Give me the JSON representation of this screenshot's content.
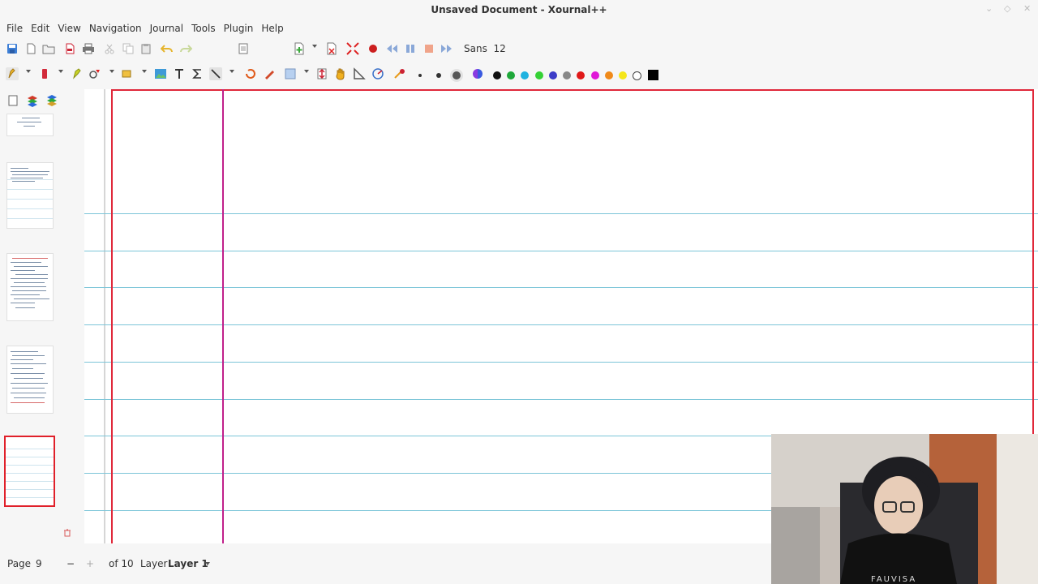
{
  "window": {
    "title": "Unsaved Document - Xournal++"
  },
  "menubar": {
    "items": [
      "File",
      "Edit",
      "View",
      "Navigation",
      "Journal",
      "Tools",
      "Plugin",
      "Help"
    ]
  },
  "toolbar1": {
    "font_name": "Sans",
    "font_size": "12"
  },
  "toolbar2": {
    "colors": [
      "#111111",
      "#1fa83a",
      "#1fb2e0",
      "#35d135",
      "#3c3cc8",
      "#888888",
      "#e01818",
      "#e018d8",
      "#f08a1a",
      "#f5e61a",
      "#ffffff",
      "#000000"
    ]
  },
  "statusbar": {
    "page_label": "Page",
    "page_value": "9",
    "of_label": "of 10",
    "layer_label": "Layer",
    "layer_value": "Layer 1"
  },
  "webcam": {
    "shirt_text": "FAUVISA"
  }
}
